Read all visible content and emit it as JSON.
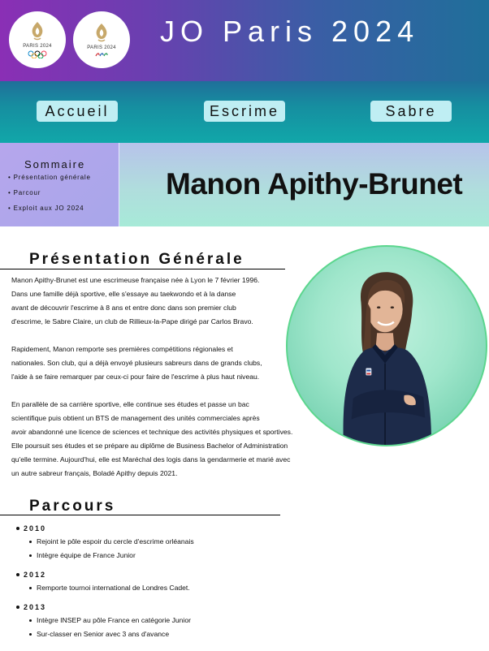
{
  "header": {
    "title": "JO Paris 2024",
    "logo_olympic_text": "PARIS 2024",
    "logo_paralympic_text": "PARIS 2024"
  },
  "nav": {
    "items": [
      {
        "label": "Accueil"
      },
      {
        "label": "Escrime"
      },
      {
        "label": "Sabre"
      }
    ]
  },
  "summary": {
    "title": "Sommaire",
    "items": [
      {
        "label": "Présentation générale"
      },
      {
        "label": "Parcour"
      },
      {
        "label": "Exploit aux JO 2024"
      }
    ]
  },
  "athlete": {
    "name": "Manon Apithy-Brunet"
  },
  "presentation": {
    "heading": "Présentation Générale",
    "paragraphs": [
      {
        "lines": [
          "Manon Apithy-Brunet est une escrimeuse française née à Lyon le 7 février 1996.",
          "Dans une famille déjà sportive, elle s'essaye au taekwondo et à la danse",
          "avant de découvrir l'escrime à 8 ans et entre donc dans son premier club",
          "d'escrime, le Sabre Claire, un club de Rillieux-la-Pape dirigé par Carlos Bravo."
        ]
      },
      {
        "lines": [
          "Rapidement, Manon remporte ses premières compétitions régionales et",
          "nationales. Son club, qui a déjà envoyé plusieurs sabreurs dans de grands clubs,",
          "l'aide à se faire remarquer par ceux-ci pour faire de l'escrime à plus haut niveau."
        ]
      },
      {
        "lines": [
          "En parallèle de sa carrière sportive, elle continue ses études et passe un bac",
          "scientifique puis obtient un BTS de management des unités commerciales après",
          "avoir abandonné une licence de sciences et technique des activités physiques et sportives.",
          "Elle poursuit ses études et se prépare au diplôme de Business Bachelor of Administration",
          "qu'elle termine. Aujourd'hui, elle est Maréchal des logis dans la gendarmerie et marié avec",
          "un autre sabreur français, Boladé Apithy depuis 2021."
        ]
      }
    ]
  },
  "parcours": {
    "heading": "Parcours",
    "years": [
      {
        "year": "2010",
        "events": [
          "Rejoint le pôle espoir du cercle d'escrime orléanais",
          "Intègre équipe de France Junior"
        ]
      },
      {
        "year": "2012",
        "events": [
          "Remporte tournoi international de Londres Cadet."
        ]
      },
      {
        "year": "2013",
        "events": [
          "Intègre INSEP au pôle France en catégorie Junior",
          "Sur-classer en Senior avec 3 ans d'avance"
        ]
      }
    ]
  },
  "colors": {
    "header_purple": "#8a2fb5",
    "header_teal": "#1f6f9a",
    "nav_button_bg": "#bfeef3",
    "summary_bg": "#b6a6ec",
    "photo_ring": "#5cd68e"
  },
  "icons": {
    "olympic_logo": "paris-2024-olympic-logo",
    "paralympic_logo": "paris-2024-paralympic-logo"
  }
}
